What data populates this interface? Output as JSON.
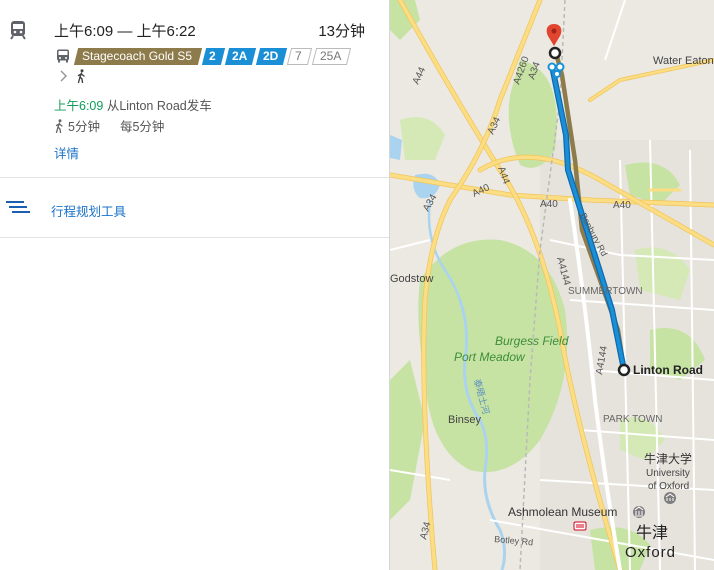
{
  "route": {
    "time_range": "上午6:09 — 上午6:22",
    "duration": "13分钟",
    "bus_operator": "Stagecoach Gold S5",
    "bus_lines": [
      "2",
      "2A",
      "2D"
    ],
    "other_lines": [
      "7",
      "25A"
    ],
    "depart_time": "上午6:09",
    "depart_from": "从Linton Road发车",
    "walk_time": "5分钟",
    "frequency": "每5分钟",
    "details_link": "详情"
  },
  "planner": {
    "label": "行程规划工具"
  },
  "map": {
    "labels": {
      "water_eaton": "Water Eaton",
      "a44_top": "A44",
      "a4260": "A4260",
      "a34_top": "A34",
      "a34_mid": "A34",
      "a44_mid": "A44",
      "a40_left": "A40",
      "a40_mid": "A40",
      "a40_right": "A40",
      "a34_left": "A34",
      "a4144_upper": "A4144",
      "a4144_lower": "A4144",
      "a34_bottom": "A34",
      "banbury_road": "Banbury Rd",
      "godstow": "Godstow",
      "summertown": "SUMMERTOWN",
      "burgess_field": "Burgess Field",
      "port_meadow": "Port Meadow",
      "river_label": "泰晤士河",
      "linton_road": "Linton Road",
      "binsey": "Binsey",
      "park_town": "PARK TOWN",
      "univ_cn": "牛津大学",
      "univ_en_1": "University",
      "univ_en_2": "of Oxford",
      "ashmolean": "Ashmolean Museum",
      "botley_rd": "Botley Rd",
      "oxford_cn": "牛津",
      "oxford_en": "Oxford"
    },
    "colors": {
      "route_transit": "#1b8fd6",
      "route_bus": "#8d7b4b",
      "destination_pin": "#e2452f",
      "park": "#c7e3a3",
      "water": "#aad3f0",
      "road_major": "#fbde83"
    }
  }
}
